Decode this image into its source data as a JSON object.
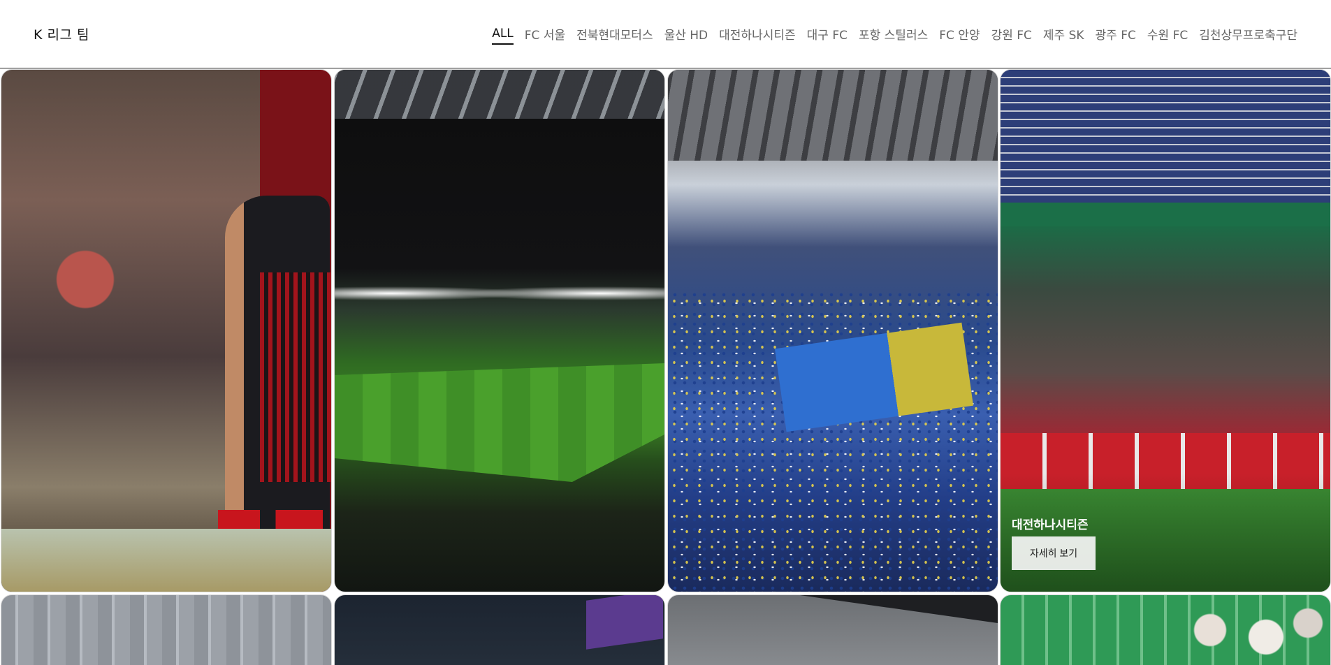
{
  "header": {
    "brand": "K 리그 팀",
    "nav": [
      {
        "label": "ALL",
        "active": true
      },
      {
        "label": "FC 서울"
      },
      {
        "label": "전북현대모터스"
      },
      {
        "label": "울산 HD"
      },
      {
        "label": "대전하나시티즌"
      },
      {
        "label": "대구 FC"
      },
      {
        "label": "포항 스틸러스"
      },
      {
        "label": "FC 안양"
      },
      {
        "label": "강원 FC"
      },
      {
        "label": "제주 SK"
      },
      {
        "label": "광주 FC"
      },
      {
        "label": "수원 FC"
      },
      {
        "label": "김천상무프로축구단"
      }
    ]
  },
  "gallery": {
    "hover_card": {
      "title": "대전하나시티즌",
      "button_label": "자세히 보기"
    }
  }
}
